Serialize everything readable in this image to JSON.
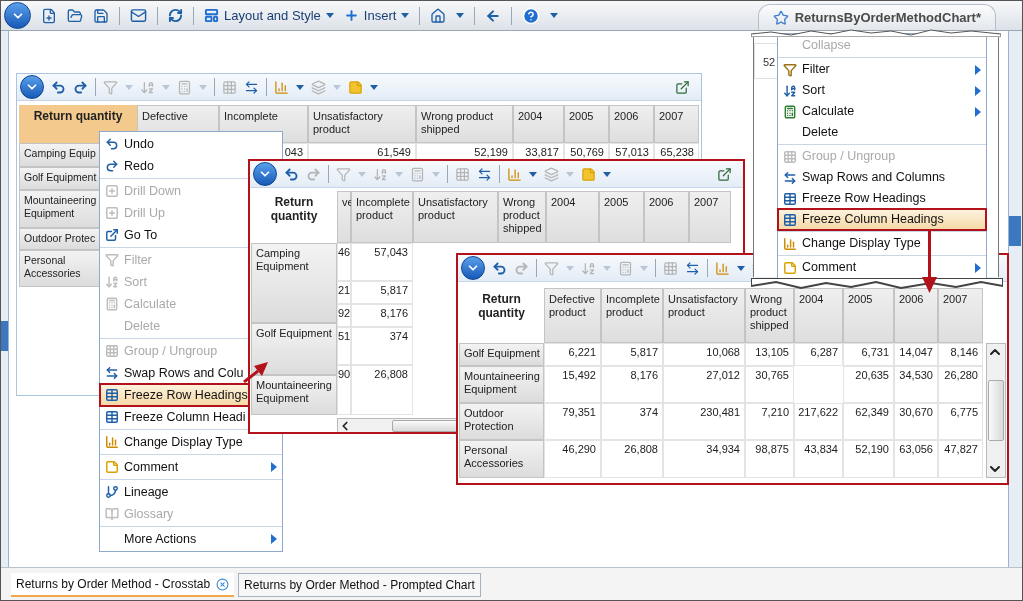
{
  "toolbar": {
    "menus": [
      {
        "label": "Layout and Style"
      },
      {
        "label": "Insert"
      }
    ],
    "document_title": "ReturnsByOrderMethodChart*"
  },
  "panels": [
    {
      "highlighted": false,
      "toolbar": {
        "redo_disabled": false
      },
      "corner": {
        "label": "Return quantity",
        "selected": true
      },
      "columns": [
        "Defective",
        "Incomplete",
        "Unsatisfactory product",
        "Wrong product shipped",
        "2004",
        "2005",
        "2006",
        "2007"
      ],
      "row_headings": [
        "Camping Equip",
        "Golf Equipment",
        "Mountaineering Equipment",
        "Outdoor Protec",
        "Personal Accessories"
      ],
      "data_rows": [
        [
          null,
          "043",
          "61,549",
          "52,199",
          "33,817",
          "50,769",
          "57,013",
          "65,238"
        ]
      ]
    },
    {
      "highlighted": true,
      "toolbar": {
        "redo_disabled": true
      },
      "corner": {
        "label": "Return quantity",
        "selected": false
      },
      "columns": [
        "ve",
        "Incomplete product",
        "Unsatisfactory product",
        "Wrong product shipped",
        "2004",
        "2005",
        "2006",
        "2007"
      ],
      "row_headings": [
        "Camping Equipment",
        "Golf Equipment",
        "Mountaineering Equipment"
      ],
      "data_rows": [
        [
          "46",
          "57,043"
        ],
        [
          "21",
          "5,817"
        ],
        [
          "92",
          "8,176"
        ],
        [
          "51",
          "374"
        ],
        [
          "90",
          "26,808"
        ]
      ]
    },
    {
      "highlighted": true,
      "toolbar": {
        "redo_disabled": true
      },
      "corner": {
        "label": "Return quantity",
        "selected": false
      },
      "columns": [
        "Defective product",
        "Incomplete product",
        "Unsatisfactory product",
        "Wrong product shipped",
        "2004",
        "2005",
        "2006",
        "2007"
      ],
      "row_headings": [
        "Golf Equipment",
        "Mountaineering Equipment",
        "Outdoor Protection",
        "Personal Accessories"
      ],
      "data_rows": [
        [
          "6,221",
          "5,817",
          "10,068",
          "13,105",
          "6,287",
          "6,731",
          "14,047",
          "8,146"
        ],
        [
          "15,492",
          "8,176",
          "27,012",
          "30,765",
          null,
          "20,635",
          "34,530",
          "26,280"
        ],
        [
          "79,351",
          "374",
          "230,481",
          "7,210",
          "217,622",
          "62,349",
          "30,670",
          "6,775"
        ],
        [
          "46,290",
          "26,808",
          "34,934",
          "98,875",
          "43,834",
          "52,190",
          "63,056",
          "47,827"
        ]
      ]
    }
  ],
  "context_menus": [
    {
      "sections": [
        {
          "items": [
            {
              "kind": "undo",
              "label": "Undo",
              "disabled": false,
              "highlighted": false
            },
            {
              "kind": "redo",
              "label": "Redo",
              "disabled": false,
              "highlighted": false
            }
          ]
        },
        {
          "items": [
            {
              "kind": "drill",
              "label": "Drill Down",
              "disabled": true,
              "highlighted": false
            },
            {
              "kind": "drill",
              "label": "Drill Up",
              "disabled": true,
              "highlighted": false
            },
            {
              "kind": "go-to",
              "label": "Go To",
              "disabled": false,
              "highlighted": false
            }
          ]
        },
        {
          "items": [
            {
              "kind": "filter",
              "label": "Filter",
              "disabled": true,
              "highlighted": false
            },
            {
              "kind": "sort",
              "label": "Sort",
              "disabled": true,
              "highlighted": false
            },
            {
              "kind": "calculate",
              "label": "Calculate",
              "disabled": true,
              "highlighted": false
            },
            {
              "kind": "plain",
              "label": "Delete",
              "disabled": true,
              "highlighted": false
            }
          ]
        },
        {
          "items": [
            {
              "kind": "group",
              "label": "Group / Ungroup",
              "disabled": true,
              "highlighted": false
            },
            {
              "kind": "swap",
              "label": "Swap Rows and Colu",
              "disabled": false,
              "highlighted": false
            },
            {
              "kind": "freeze",
              "label": "Freeze Row Headings",
              "disabled": false,
              "highlighted": true
            },
            {
              "kind": "freeze",
              "label": "Freeze Column Headi",
              "disabled": false,
              "highlighted": false
            }
          ]
        },
        {
          "items": [
            {
              "kind": "display-type",
              "label": "Change Display Type",
              "disabled": false,
              "highlighted": false
            }
          ]
        },
        {
          "items": [
            {
              "kind": "comment",
              "label": "Comment",
              "disabled": false,
              "highlighted": false,
              "submenu": true
            }
          ]
        },
        {
          "items": [
            {
              "kind": "lineage",
              "label": "Lineage",
              "disabled": false,
              "highlighted": false,
              "submenu": false
            },
            {
              "kind": "glossary",
              "label": "Glossary",
              "disabled": true,
              "highlighted": false,
              "submenu": false
            }
          ]
        },
        {
          "items": [
            {
              "kind": "plain",
              "label": "More Actions",
              "disabled": false,
              "highlighted": false,
              "submenu": true
            }
          ]
        }
      ]
    },
    {
      "sections": [
        {
          "items": [
            {
              "kind": "plain",
              "label": "Collapse",
              "disabled": true,
              "highlighted": false,
              "submenu": false
            }
          ]
        },
        {
          "items": [
            {
              "kind": "filter",
              "label": "Filter",
              "disabled": false,
              "highlighted": false,
              "submenu": true
            },
            {
              "kind": "sort",
              "label": "Sort",
              "disabled": false,
              "highlighted": false,
              "submenu": true
            },
            {
              "kind": "calculate",
              "label": "Calculate",
              "disabled": false,
              "highlighted": false,
              "submenu": true
            },
            {
              "kind": "plain",
              "label": "Delete",
              "disabled": false,
              "highlighted": false,
              "submenu": false
            }
          ]
        },
        {
          "items": [
            {
              "kind": "group",
              "label": "Group / Ungroup",
              "disabled": true,
              "highlighted": false,
              "submenu": false
            },
            {
              "kind": "swap",
              "label": "Swap Rows and Columns",
              "disabled": false,
              "highlighted": false,
              "submenu": false
            },
            {
              "kind": "freeze",
              "label": "Freeze Row Headings",
              "disabled": false,
              "highlighted": false,
              "submenu": false
            },
            {
              "kind": "freeze",
              "label": "Freeze Column Headings",
              "disabled": false,
              "highlighted": true,
              "submenu": false
            }
          ]
        },
        {
          "items": [
            {
              "kind": "display-type",
              "label": "Change Display Type",
              "disabled": false,
              "highlighted": false,
              "submenu": false
            }
          ]
        },
        {
          "items": [
            {
              "kind": "comment",
              "label": "Comment",
              "disabled": false,
              "highlighted": false,
              "submenu": true
            }
          ]
        }
      ]
    }
  ],
  "cut_off_cell": "52",
  "tabs": [
    {
      "label": "Returns by Order Method - Crosstab",
      "selected": true,
      "closable": true
    },
    {
      "label": "Returns by Order Method - Prompted Chart",
      "selected": false,
      "closable": false
    }
  ]
}
